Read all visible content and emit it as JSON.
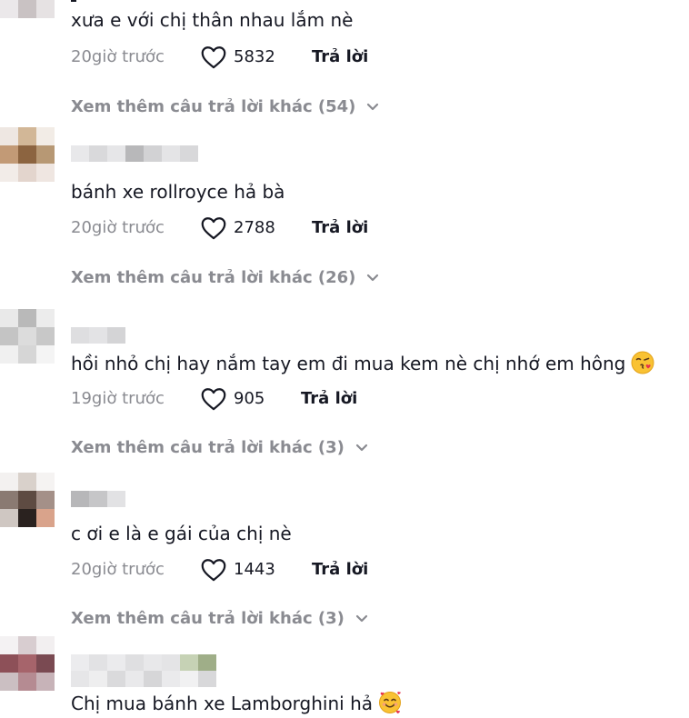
{
  "comments": [
    {
      "text": "xưa e với chị thân nhau lắm nè",
      "time": "20giờ trước",
      "likes": "5832",
      "reply_label": "Trả lời",
      "more_replies": "Xem thêm câu trả lời khác (54)"
    },
    {
      "text": "bánh xe rollroyce hả bà",
      "time": "20giờ trước",
      "likes": "2788",
      "reply_label": "Trả lời",
      "more_replies": "Xem thêm câu trả lời khác (26)"
    },
    {
      "text": "hồi nhỏ chị hay nắm tay em đi mua kem nè chị nhớ em hông",
      "emoji": "face-blowing-kiss",
      "time": "19giờ trước",
      "likes": "905",
      "reply_label": "Trả lời",
      "more_replies": "Xem thêm câu trả lời khác (3)"
    },
    {
      "text": "c ơi e là e gái của chị nè",
      "time": "20giờ trước",
      "likes": "1443",
      "reply_label": "Trả lời",
      "more_replies": "Xem thêm câu trả lời khác (3)"
    },
    {
      "text": "Chị mua bánh xe Lamborghini hả",
      "emoji": "smiling-face-with-hearts"
    }
  ],
  "colors": {
    "muted_text": "#8a8b91",
    "primary_text": "#161823"
  },
  "icons": {
    "like": "heart-outline-icon",
    "expand": "chevron-down-icon"
  }
}
